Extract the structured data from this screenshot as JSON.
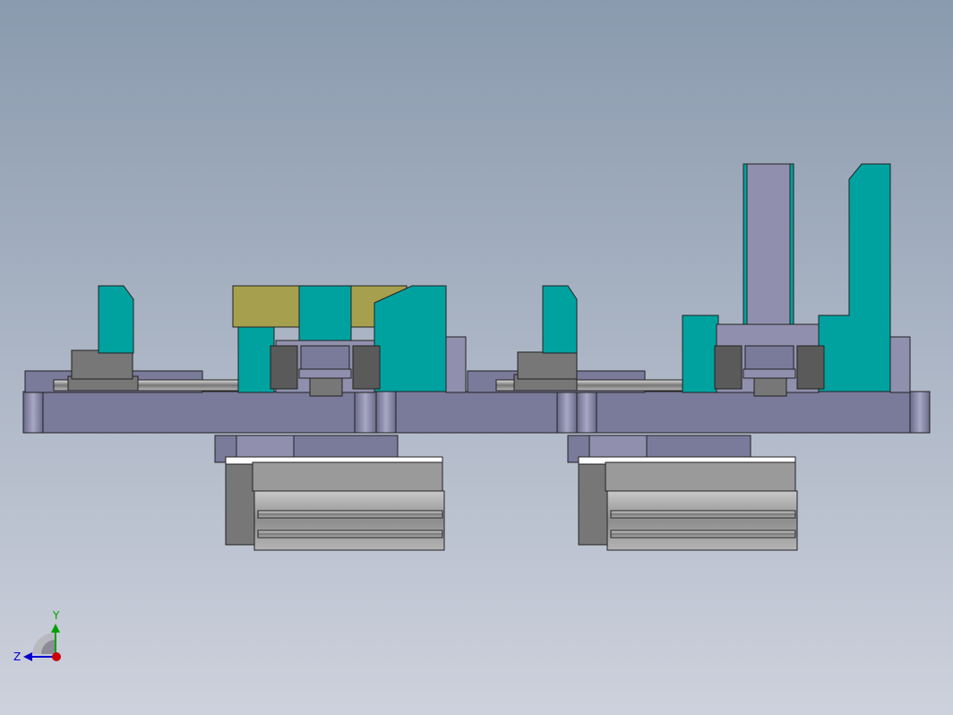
{
  "viewport": {
    "background_top": "#8a9aae",
    "background_bottom": "#cdd1dc",
    "colors": {
      "base": "#7a7a9a",
      "base_dark": "#5e5e7c",
      "base_light": "#9090ae",
      "teal": "#00a2a0",
      "teal_dark": "#007a78",
      "olive": "#a6a04e",
      "gray": "#777777",
      "gray_dark": "#5a5a5a",
      "cylinder": "#9a9a9a",
      "cylinder_light": "#c4c4c4",
      "outline": "#222222"
    }
  },
  "triad": {
    "x_axis_color": "#cc0000",
    "y_axis_color": "#00a000",
    "z_axis_color": "#0000cc",
    "y_label": "Y",
    "z_label": "Z",
    "icon": "reference-triad-icon"
  }
}
